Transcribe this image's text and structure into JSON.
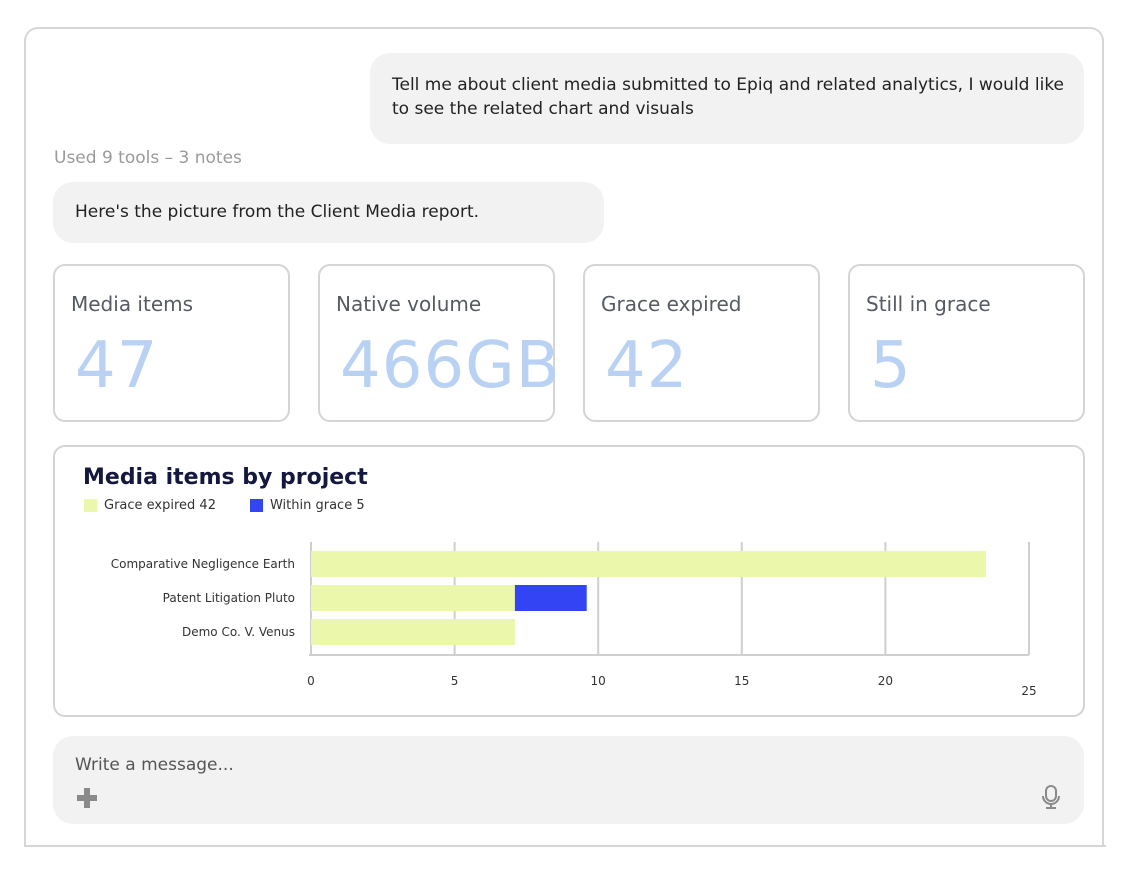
{
  "conversation": {
    "user_message": "Tell me about client media submitted to Epiq and related analytics, I would like to see the related chart and visuals",
    "tools_summary": "Used 9 tools – 3 notes",
    "assistant_message": "Here's the picture from the Client Media report."
  },
  "stats": [
    {
      "label": "Media items",
      "value": "47"
    },
    {
      "label": "Native volume",
      "value": "466GB"
    },
    {
      "label": "Grace expired",
      "value": "42"
    },
    {
      "label": "Still in grace",
      "value": "5"
    }
  ],
  "chart_data": {
    "type": "bar",
    "orientation": "horizontal",
    "stacked": true,
    "title": "Media items by project",
    "categories": [
      "Comparative Negligence Earth",
      "Patent Litigation Pluto",
      "Demo Co. V. Venus"
    ],
    "series": [
      {
        "name": "Grace expired 42",
        "values": [
          23.5,
          7.1,
          7.1
        ],
        "color": "#ebf7ab"
      },
      {
        "name": "Within grace 5",
        "values": [
          0,
          2.5,
          0
        ],
        "color": "#3344f5"
      }
    ],
    "xlim": [
      0,
      25
    ],
    "x_ticks": [
      "0",
      "5",
      "10",
      "15",
      "20",
      "25"
    ],
    "grid": true,
    "legend_position": "top-left"
  },
  "composer": {
    "placeholder": "Write a message...",
    "attach_icon": "plus-icon",
    "voice_icon": "microphone-icon"
  },
  "colors": {
    "stat_value": "#b9d2f3",
    "bubble_bg": "#f2f2f2",
    "title": "#14173e"
  }
}
